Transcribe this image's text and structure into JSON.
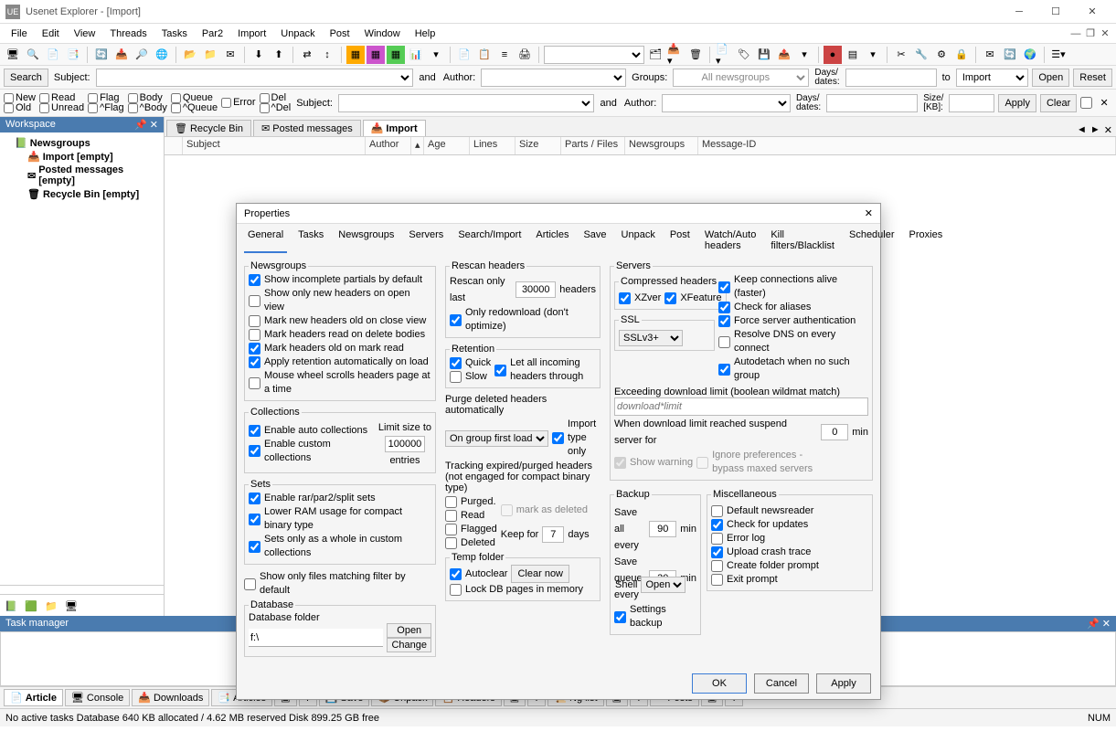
{
  "title": "Usenet Explorer - [Import]",
  "menu": [
    "File",
    "Edit",
    "View",
    "Threads",
    "Tasks",
    "Par2",
    "Import",
    "Unpack",
    "Post",
    "Window",
    "Help"
  ],
  "search": {
    "btn": "Search",
    "subject": "Subject:",
    "and": "and",
    "author": "Author:",
    "groups": "Groups:",
    "allgroups": "All newsgroups",
    "daysdates": "Days/\ndates:",
    "to": "to",
    "import": "Import",
    "open": "Open",
    "reset": "Reset"
  },
  "filter": {
    "new": "New",
    "old": "Old",
    "read": "Read",
    "unread": "Unread",
    "flag": "Flag",
    "nflag": "^Flag",
    "body": "Body",
    "nbody": "^Body",
    "queue": "Queue",
    "nqueue": "^Queue",
    "error": "Error",
    "del": "Del",
    "ndel": "^Del",
    "subject": "Subject:",
    "author": "Author:",
    "sizekb": "Size/\n[KB]:",
    "apply": "Apply",
    "clear": "Clear"
  },
  "sidebar": {
    "title": "Workspace",
    "root": "Newsgroups",
    "imp": "Import  [empty]",
    "posted": "Posted messages  [empty]",
    "recycle": "Recycle Bin  [empty]"
  },
  "wtabs": {
    "recycle": "Recycle Bin",
    "posted": "Posted messages",
    "import": "Import"
  },
  "cols": {
    "subject": "Subject",
    "author": "Author",
    "age": "Age",
    "lines": "Lines",
    "size": "Size",
    "parts": "Parts / Files",
    "groups": "Newsgroups",
    "msgid": "Message-ID"
  },
  "btabs": {
    "article": "Article",
    "console": "Console",
    "downloads": "Downloads",
    "articles": "Articles",
    "save": "Save",
    "unpack": "Unpack",
    "headers": "Headers",
    "nglist": "Ng list",
    "posts": "Posts",
    "q": "?"
  },
  "status": {
    "left": "No active tasks  Database 640 KB allocated / 4.62 MB reserved  Disk 899.25 GB free",
    "num": "NUM"
  },
  "taskmgr": "Task manager",
  "dlg": {
    "title": "Properties",
    "tabs": [
      "General",
      "Tasks",
      "Newsgroups",
      "Servers",
      "Search/Import",
      "Articles",
      "Save",
      "Unpack",
      "Post",
      "Watch/Auto headers",
      "Kill filters/Blacklist",
      "Scheduler",
      "Proxies"
    ],
    "newsgroups_legend": "Newsgroups",
    "ng": {
      "a": "Show incomplete partials by default",
      "b": "Show only new headers on open view",
      "c": "Mark new headers old on close view",
      "d": "Mark headers read on delete bodies",
      "e": "Mark headers old on mark read",
      "f": "Apply retention automatically on load",
      "g": "Mouse wheel scrolls headers page at a time"
    },
    "collections_legend": "Collections",
    "col": {
      "a": "Enable auto collections",
      "b": "Enable custom collections"
    },
    "limit": "Limit size to",
    "limit_val": "100000",
    "entries": "entries",
    "sets_legend": "Sets",
    "sets": {
      "a": "Enable rar/par2/split sets",
      "b": "Lower RAM usage for compact binary type",
      "c": "Sets only as a whole in custom collections"
    },
    "filterdef": "Show only files matching filter by default",
    "db_legend": "Database",
    "db_folder": "Database folder",
    "db_val": "f:\\",
    "db_open": "Open",
    "db_change": "Change",
    "rescan_legend": "Rescan headers",
    "rescan_last": "Rescan only last",
    "rescan_val": "30000",
    "rescan_headers": "headers",
    "rescan_opt": "Only redownload (don't optimize)",
    "ret_legend": "Retention",
    "ret_quick": "Quick",
    "ret_slow": "Slow",
    "ret_let": "Let all incoming\nheaders through",
    "purge": "Purge deleted headers automatically",
    "purge_opt": "On group first load",
    "purge_imp": "Import\ntype only",
    "track": "Tracking expired/purged headers\n(not engaged for compact binary type)",
    "track_purged": "Purged.",
    "track_mark": "mark as deleted",
    "track_read": "Read",
    "track_flag": "Flagged",
    "track_del": "Deleted",
    "keep": "Keep for",
    "keep_val": "7",
    "days": "days",
    "temp_legend": "Temp folder",
    "autoclear": "Autoclear",
    "clearnow": "Clear now",
    "lockdb": "Lock DB pages in memory",
    "servers_legend": "Servers",
    "comp_legend": "Compressed headers",
    "xzver": "XZver",
    "xfeat": "XFeature",
    "srv": {
      "a": "Keep connections alive (faster)",
      "b": "Check for aliases",
      "c": "Force server authentication",
      "d": "Resolve DNS on every connect",
      "e": "Autodetach when no such group"
    },
    "ssl_legend": "SSL",
    "ssl_opt": "SSLv3+",
    "exceed": "Exceeding download limit (boolean wildmat match)",
    "exceed_ph": "download*limit",
    "suspend": "When download limit reached suspend server for",
    "suspend_val": "0",
    "min": "min",
    "showwarn": "Show warning",
    "ignore": "Ignore preferences -\nbypass maxed servers",
    "backup_legend": "Backup",
    "saveall": "Save all\nevery",
    "bkp_val": "90",
    "savequeue": "Save queue\nevery",
    "bkpq_val": "30",
    "settingsbkp": "Settings backup",
    "misc_legend": "Miscellaneous",
    "misc": {
      "a": "Default newsreader",
      "b": "Check for updates",
      "c": "Error log",
      "d": "Upload crash trace",
      "e": "Create folder prompt",
      "f": "Exit prompt"
    },
    "shell": "Shell",
    "shell_opt": "Open",
    "ok": "OK",
    "cancel": "Cancel",
    "apply": "Apply"
  }
}
